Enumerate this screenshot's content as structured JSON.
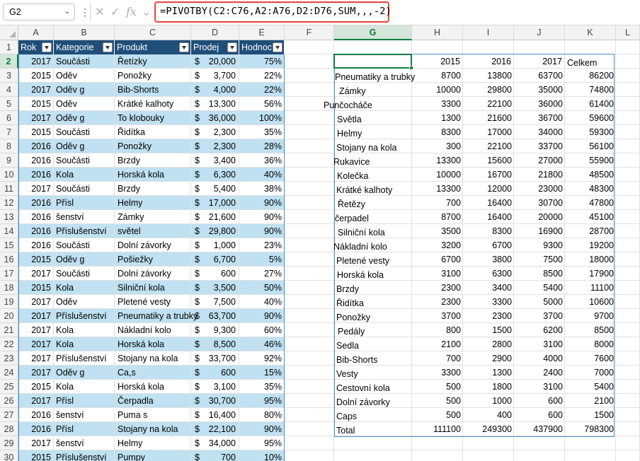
{
  "name_box": "G2",
  "formula": "=PIVOTBY(C2:C76,A2:A76,D2:D76,SUM,,,-2)",
  "columns": [
    "A",
    "B",
    "C",
    "D",
    "E",
    "F",
    "G",
    "H",
    "I",
    "J",
    "K",
    "L"
  ],
  "rows": [
    "1",
    "2",
    "3",
    "4",
    "5",
    "6",
    "7",
    "8",
    "9",
    "10",
    "11",
    "12",
    "13",
    "14",
    "15",
    "16",
    "17",
    "18",
    "19",
    "20",
    "21",
    "22",
    "23",
    "24",
    "25",
    "26",
    "27",
    "28",
    "29",
    "30"
  ],
  "table": {
    "headers": [
      "Rok",
      "Kategorie",
      "Produkt",
      "Prodej",
      "Hodnoc"
    ],
    "rows": [
      [
        "2017",
        "Součásti",
        "Řetízky",
        "$",
        "20,000",
        "75%"
      ],
      [
        "2015",
        "Oděv",
        "Ponožky",
        "$",
        "3,700",
        "22%"
      ],
      [
        "2017",
        "Oděv       g",
        "Bib-Shorts",
        "$",
        "4,000",
        "22%"
      ],
      [
        "2015",
        "Oděv",
        "Krátké kalhoty",
        "$",
        "13,300",
        "56%"
      ],
      [
        "2017",
        "Oděv       g",
        "To klobouky",
        "$",
        "36,000",
        "100%"
      ],
      [
        "2015",
        "Součásti",
        "Řidítka",
        "$",
        "2,300",
        "35%"
      ],
      [
        "2016",
        "Oděv       g",
        "Ponožky",
        "$",
        "2,300",
        "28%"
      ],
      [
        "2016",
        "Součásti",
        "Brzdy",
        "$",
        "3,400",
        "36%"
      ],
      [
        "2016",
        "Kola",
        "Horská kola",
        "$",
        "6,300",
        "40%"
      ],
      [
        "2017",
        "Součásti",
        "Brzdy",
        "$",
        "5,400",
        "38%"
      ],
      [
        "2016",
        "Přísl",
        "Helmy",
        "$",
        "17,000",
        "90%"
      ],
      [
        "2016",
        "šenství",
        "Zámky",
        "$",
        "21,600",
        "90%"
      ],
      [
        "2016",
        "Příslušenství",
        "světel",
        "$",
        "29,800",
        "90%"
      ],
      [
        "2016",
        "Součásti",
        "Dolní závorky",
        "$",
        "1,000",
        "23%"
      ],
      [
        "2015",
        "Oděv       g",
        "Pošiežky",
        "$",
        "6,700",
        "5%"
      ],
      [
        "2017",
        "Součásti",
        "Dolní závorky",
        "$",
        "600",
        "27%"
      ],
      [
        "2015",
        "Kola",
        "Silniční kola",
        "$",
        "3,500",
        "50%"
      ],
      [
        "2017",
        "Oděv",
        "Pletené vesty",
        "$",
        "7,500",
        "40%"
      ],
      [
        "2017",
        "Příslušenství",
        "Pneumatiky a trubky",
        "$",
        "63,700",
        "90%"
      ],
      [
        "2017",
        "Kola",
        "Nákladní kolo",
        "$",
        "9,300",
        "60%"
      ],
      [
        "2017",
        "Kola",
        "Horská kola",
        "$",
        "8,500",
        "46%"
      ],
      [
        "2017",
        "Příslušenství",
        "Stojany na kola",
        "$",
        "33,700",
        "92%"
      ],
      [
        "2017",
        "Oděv       g",
        "Ca,s",
        "$",
        "600",
        "15%"
      ],
      [
        "2015",
        "Kola",
        "Horská kola",
        "$",
        "3,100",
        "35%"
      ],
      [
        "2017",
        "Přísl",
        "Čerpadla",
        "$",
        "30,700",
        "95%"
      ],
      [
        "2016",
        "šenství",
        "Puma s",
        "$",
        "16,400",
        "80%"
      ],
      [
        "2016",
        "Přísl",
        "Stojany na kola",
        "$",
        "22,100",
        "90%"
      ],
      [
        "2017",
        "šenství",
        "Helmy",
        "$",
        "34,000",
        "95%"
      ],
      [
        "2015",
        "Příslušenství",
        "Pumpy",
        "$",
        "700",
        "10%"
      ]
    ]
  },
  "pivot": {
    "header": [
      "",
      "2015",
      "2016",
      "2017",
      "Celkem"
    ],
    "rows": [
      [
        "Pneumatiky a trubky",
        "8700",
        "13800",
        "63700",
        "86200"
      ],
      [
        "Zámky",
        "10000",
        "29800",
        "35000",
        "74800"
      ],
      [
        "Punčocháče",
        "3300",
        "22100",
        "36000",
        "61400"
      ],
      [
        "Světla",
        "1300",
        "21600",
        "36700",
        "59600"
      ],
      [
        "Helmy",
        "8300",
        "17000",
        "34000",
        "59300"
      ],
      [
        "Stojany na kola",
        "300",
        "22100",
        "33700",
        "56100"
      ],
      [
        "Rukavice",
        "13300",
        "15600",
        "27000",
        "55900"
      ],
      [
        "Kolečka",
        "10000",
        "16700",
        "21800",
        "48500"
      ],
      [
        "Krátké kalhoty",
        "13300",
        "12000",
        "23000",
        "48300"
      ],
      [
        "Řetězy",
        "700",
        "16400",
        "30700",
        "47800"
      ],
      [
        "čerpadel",
        "8700",
        "16400",
        "20000",
        "45100"
      ],
      [
        "Silniční kola",
        "3500",
        "8300",
        "16900",
        "28700"
      ],
      [
        "Nákladní kolo",
        "3200",
        "6700",
        "9300",
        "19200"
      ],
      [
        "Pletené vesty",
        "6700",
        "3800",
        "7500",
        "18000"
      ],
      [
        "Horská kola",
        "3100",
        "6300",
        "8500",
        "17900"
      ],
      [
        "Brzdy",
        "2300",
        "3400",
        "5400",
        "11100"
      ],
      [
        "Řidítka",
        "2300",
        "3300",
        "5000",
        "10600"
      ],
      [
        "Ponožky",
        "3700",
        "2300",
        "3700",
        "9700"
      ],
      [
        "Pedály",
        "800",
        "1500",
        "6200",
        "8500"
      ],
      [
        "Sedla",
        "2100",
        "2800",
        "3100",
        "8000"
      ],
      [
        "Bib-Shorts",
        "700",
        "2900",
        "4000",
        "7600"
      ],
      [
        "Vesty",
        "3300",
        "1300",
        "2400",
        "7000"
      ],
      [
        "Cestovní kola",
        "500",
        "1800",
        "3100",
        "5400"
      ],
      [
        "Dolní závorky",
        "500",
        "1000",
        "600",
        "2100"
      ],
      [
        "Caps",
        "500",
        "400",
        "600",
        "1500"
      ],
      [
        "Total",
        "111100",
        "249300",
        "437900",
        "798300"
      ]
    ]
  },
  "colors": {
    "table_header": "#1f4e79",
    "band": "#bfe1f1",
    "selection": "#107c41",
    "highlight": "#e3463c"
  }
}
